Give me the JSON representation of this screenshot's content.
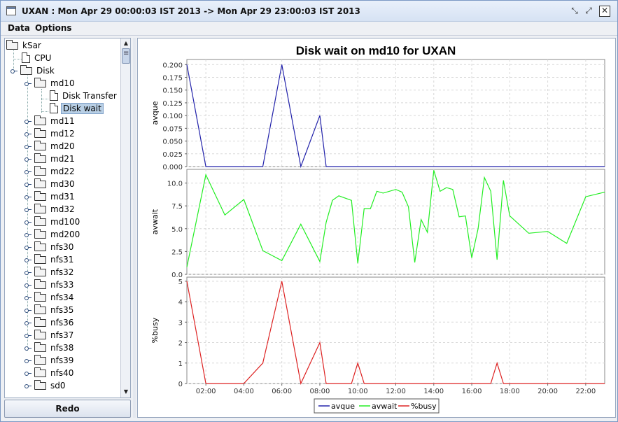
{
  "window": {
    "title": "UXAN : Mon Apr 29 00:00:03 IST 2013 -> Mon Apr 29 23:00:03 IST 2013"
  },
  "menu": [
    "Data",
    "Options"
  ],
  "tree": {
    "root": "kSar",
    "items": [
      "CPU",
      "Disk"
    ],
    "disk_children": [
      "md10",
      "md11",
      "md12",
      "md20",
      "md21",
      "md22",
      "md30",
      "md31",
      "md32",
      "md100",
      "md200",
      "nfs30",
      "nfs31",
      "nfs32",
      "nfs33",
      "nfs34",
      "nfs35",
      "nfs36",
      "nfs37",
      "nfs38",
      "nfs39",
      "nfs40",
      "sd0"
    ],
    "md10_children": [
      "Disk Transfer",
      "Disk wait"
    ],
    "selected": "Disk wait"
  },
  "redo_label": "Redo",
  "colors": {
    "avque": "#2222aa",
    "avwait": "#22ee22",
    "busy": "#dd2222",
    "grid": "#d8d8d8"
  },
  "chart_data": {
    "type": "line",
    "title": "Disk wait on md10 for UXAN",
    "x_ticks": [
      "02:00",
      "04:00",
      "06:00",
      "08:00",
      "10:00",
      "12:00",
      "14:00",
      "16:00",
      "18:00",
      "20:00",
      "22:00"
    ],
    "xlim": [
      "01:00",
      "23:00"
    ],
    "legend": [
      "avque",
      "avwait",
      "%busy"
    ],
    "legend_position": "bottom",
    "grid": true,
    "panels": [
      {
        "ylabel": "avque",
        "ylim": [
          0,
          0.21
        ],
        "yticks": [
          "0.000",
          "0.025",
          "0.050",
          "0.075",
          "0.100",
          "0.125",
          "0.150",
          "0.175",
          "0.200"
        ],
        "ytick_values": [
          0,
          0.025,
          0.05,
          0.075,
          0.1,
          0.125,
          0.15,
          0.175,
          0.2
        ],
        "series": [
          {
            "name": "avque",
            "points": [
              [
                "01:00",
                0.2
              ],
              [
                "02:00",
                0
              ],
              [
                "05:00",
                0
              ],
              [
                "06:00",
                0.2
              ],
              [
                "07:00",
                0
              ],
              [
                "08:00",
                0.1
              ],
              [
                "08:20",
                0
              ],
              [
                "23:00",
                0
              ]
            ]
          }
        ]
      },
      {
        "ylabel": "avwait",
        "ylim": [
          0,
          11.5
        ],
        "yticks": [
          "0.0",
          "2.5",
          "5.0",
          "7.5",
          "10.0"
        ],
        "ytick_values": [
          0,
          2.5,
          5,
          7.5,
          10
        ],
        "series": [
          {
            "name": "avwait",
            "points": [
              [
                "01:00",
                0.8
              ],
              [
                "02:00",
                10.9
              ],
              [
                "03:00",
                6.5
              ],
              [
                "04:00",
                8.2
              ],
              [
                "05:00",
                2.6
              ],
              [
                "06:00",
                1.5
              ],
              [
                "07:00",
                5.5
              ],
              [
                "08:00",
                1.4
              ],
              [
                "08:20",
                5.7
              ],
              [
                "08:40",
                8.1
              ],
              [
                "09:00",
                8.6
              ],
              [
                "09:40",
                8.1
              ],
              [
                "10:00",
                1.2
              ],
              [
                "10:20",
                7.2
              ],
              [
                "10:40",
                7.2
              ],
              [
                "11:00",
                9.1
              ],
              [
                "11:20",
                8.9
              ],
              [
                "12:00",
                9.3
              ],
              [
                "12:20",
                9.0
              ],
              [
                "12:40",
                7.4
              ],
              [
                "13:00",
                1.3
              ],
              [
                "13:20",
                6.0
              ],
              [
                "13:40",
                4.6
              ],
              [
                "14:00",
                11.4
              ],
              [
                "14:20",
                9.1
              ],
              [
                "14:40",
                9.5
              ],
              [
                "15:00",
                9.3
              ],
              [
                "15:20",
                6.3
              ],
              [
                "15:40",
                6.4
              ],
              [
                "16:00",
                1.8
              ],
              [
                "16:20",
                5.0
              ],
              [
                "16:40",
                10.6
              ],
              [
                "17:00",
                9.1
              ],
              [
                "17:20",
                1.6
              ],
              [
                "17:40",
                10.3
              ],
              [
                "18:00",
                6.4
              ],
              [
                "19:00",
                4.5
              ],
              [
                "20:00",
                4.7
              ],
              [
                "21:00",
                3.4
              ],
              [
                "22:00",
                8.5
              ],
              [
                "23:00",
                9.0
              ]
            ]
          }
        ]
      },
      {
        "ylabel": "%busy",
        "ylim": [
          0,
          5.2
        ],
        "yticks": [
          "0",
          "1",
          "2",
          "3",
          "4",
          "5"
        ],
        "ytick_values": [
          0,
          1,
          2,
          3,
          4,
          5
        ],
        "series": [
          {
            "name": "%busy",
            "points": [
              [
                "01:00",
                5
              ],
              [
                "02:00",
                0
              ],
              [
                "04:00",
                0
              ],
              [
                "05:00",
                1
              ],
              [
                "06:00",
                5
              ],
              [
                "07:00",
                0
              ],
              [
                "08:00",
                2
              ],
              [
                "08:20",
                0
              ],
              [
                "09:40",
                0
              ],
              [
                "10:00",
                1
              ],
              [
                "10:20",
                0
              ],
              [
                "17:00",
                0
              ],
              [
                "17:20",
                1
              ],
              [
                "17:40",
                0
              ],
              [
                "23:00",
                0
              ]
            ]
          }
        ]
      }
    ]
  }
}
